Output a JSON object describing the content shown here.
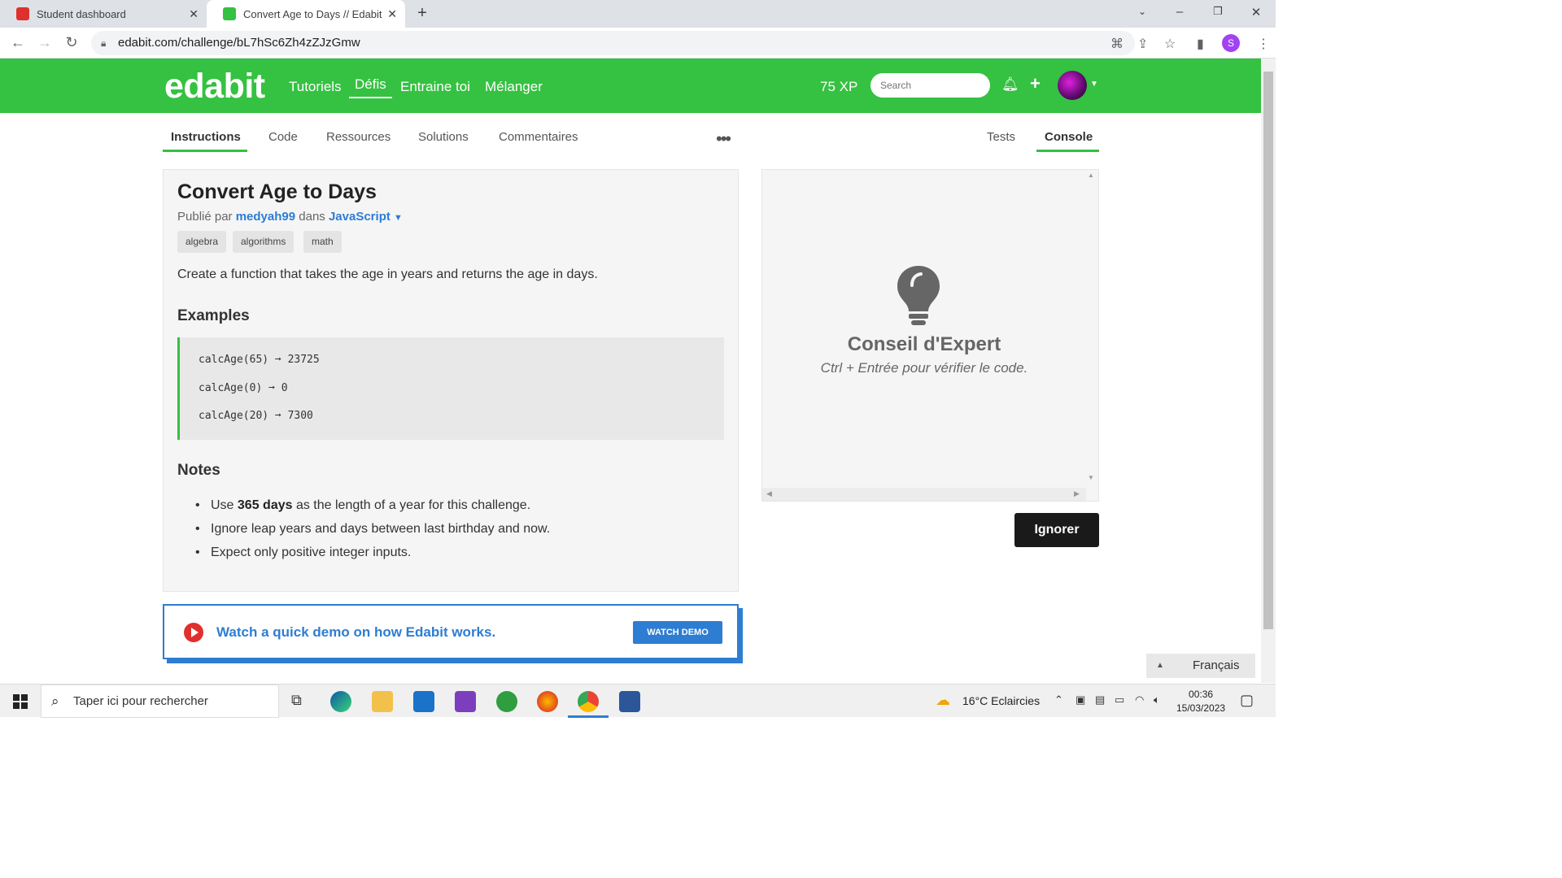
{
  "browser": {
    "tabs": [
      {
        "title": "Student dashboard",
        "active": false
      },
      {
        "title": "Convert Age to Days // Edabit",
        "active": true
      }
    ],
    "url": "edabit.com/challenge/bL7hSc6Zh4zZJzGmw",
    "profile_initial": "S"
  },
  "site": {
    "logo": "edabit",
    "nav": [
      "Tutoriels",
      "Défis",
      "Entraine toi",
      "Mélanger"
    ],
    "active_nav": "Défis",
    "xp": "75 XP",
    "search_placeholder": "Search"
  },
  "content_tabs": {
    "left": [
      "Instructions",
      "Code",
      "Ressources",
      "Solutions",
      "Commentaires"
    ],
    "more": "•••",
    "right": [
      "Tests",
      "Console"
    ],
    "active_left": "Instructions",
    "active_right": "Console"
  },
  "challenge": {
    "title": "Convert Age to Days",
    "published_prefix": "Publié par",
    "author": "medyah99",
    "in_word": "dans",
    "language": "JavaScript",
    "tags": [
      "algebra",
      "algorithms",
      "math"
    ],
    "description": "Create a function that takes the age in years and returns the age in days.",
    "examples_heading": "Examples",
    "examples": [
      "calcAge(65) ➞ 23725",
      "calcAge(0) ➞ 0",
      "calcAge(20) ➞ 7300"
    ],
    "notes_heading": "Notes",
    "notes": [
      {
        "pre": "Use ",
        "bold": "365 days",
        "post": " as the length of a year for this challenge."
      },
      {
        "pre": "Ignore leap years and days between last birthday and now.",
        "bold": "",
        "post": ""
      },
      {
        "pre": "Expect only positive integer inputs.",
        "bold": "",
        "post": ""
      }
    ]
  },
  "demo": {
    "text": "Watch a quick demo on how Edabit works.",
    "button": "WATCH DEMO"
  },
  "console_panel": {
    "tip_title": "Conseil d'Expert",
    "tip_text": "Ctrl + Entrée pour vérifier le code.",
    "ignore_button": "Ignorer"
  },
  "language_selector": "Français",
  "taskbar": {
    "search_placeholder": "Taper ici pour rechercher",
    "weather": "16°C  Eclaircies",
    "time": "00:36",
    "date": "15/03/2023"
  },
  "colors": {
    "brand_green": "#35c141",
    "link_blue": "#2d7dd2"
  }
}
